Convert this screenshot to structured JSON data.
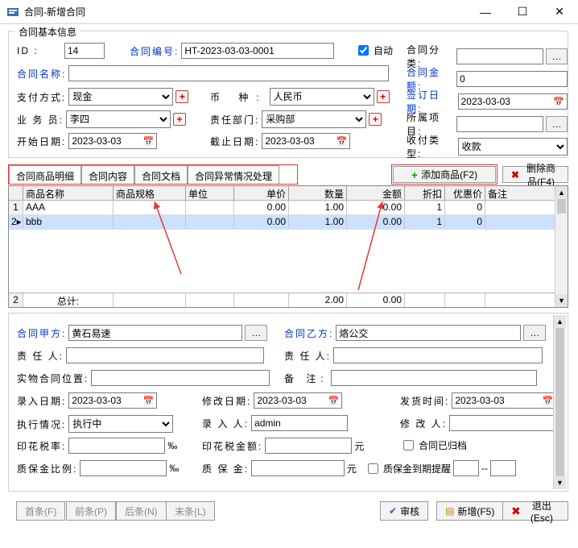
{
  "window": {
    "title": "合同-新增合同"
  },
  "basic": {
    "legend": "合同基本信息",
    "id_label": "ID    :",
    "id_value": "14",
    "code_label": "合同编号:",
    "code_value": "HT-2023-03-03-0001",
    "auto_label": "自动",
    "category_label": "合同分类:",
    "name_label": "合同名称:",
    "amount_label": "合同金额:",
    "amount_value": "0",
    "paymode_label": "支付方式:",
    "paymode_value": "现金",
    "currency_label": "币    种:",
    "currency_value": "人民币",
    "signdate_label": "签订日期:",
    "signdate_value": "2023-03-03",
    "salesman_label": "业 务 员:",
    "salesman_value": "李四",
    "dept_label": "责任部门:",
    "dept_value": "采购部",
    "project_label": "所属项目:",
    "start_label": "开始日期:",
    "start_value": "2023-03-03",
    "end_label": "截止日期:",
    "end_value": "2023-03-03",
    "rptype_label": "收付类型:",
    "rptype_value": "收款"
  },
  "tabs": {
    "t1": "合同商品明细",
    "t2": "合同内容",
    "t3": "合同文档",
    "t4": "合同异常情况处理",
    "add_btn": "添加商品(F2)",
    "del_btn": "删除商品(F4)"
  },
  "grid": {
    "headers": {
      "name": "商品名称",
      "spec": "商品规格",
      "unit": "单位",
      "price": "单价",
      "qty": "数量",
      "amt": "金额",
      "disc": "折扣",
      "off": "优惠价",
      "note": "备注"
    },
    "rows": [
      {
        "idx": "1",
        "name": "AAA",
        "spec": "",
        "unit": "",
        "price": "0.00",
        "qty": "1.00",
        "amt": "0.00",
        "disc": "1",
        "off": "0",
        "note": ""
      },
      {
        "idx": "2",
        "name": "bbb",
        "spec": "",
        "unit": "",
        "price": "0.00",
        "qty": "1.00",
        "amt": "0.00",
        "disc": "1",
        "off": "0",
        "note": ""
      }
    ],
    "footer": {
      "idx": "2",
      "label": "总计:",
      "qty": "2.00",
      "amt": "0.00"
    }
  },
  "party": {
    "a_label": "合同甲方:",
    "a_value": "黄石易速",
    "b_label": "合同乙方:",
    "b_value": "烙公交",
    "a_person_label": "责 任 人:",
    "b_person_label": "责 任 人:",
    "loc_label": "实物合同位置:",
    "remark_label": "备    注:",
    "entry_date_label": "录入日期:",
    "entry_date_value": "2023-03-03",
    "modify_date_label": "修改日期:",
    "modify_date_value": "2023-03-03",
    "ship_date_label": "发货时间:",
    "ship_date_value": "2023-03-03",
    "exec_label": "执行情况:",
    "exec_value": "执行中",
    "entry_by_label": "录 入 人:",
    "entry_by_value": "admin",
    "modify_by_label": "修 改 人:",
    "tax_rate_label": "印花税率:",
    "tax_rate_unit": "‰",
    "tax_amt_label": "印花税金额:",
    "yuan": "元",
    "archived_label": "合同已归档",
    "deposit_rate_label": "质保金比例:",
    "deposit_rate_unit": "‰",
    "deposit_label": "质 保 金:",
    "deposit_remind_label": "质保金到期提醒",
    "remind_sep": "--"
  },
  "nav": {
    "first": "首条(F)",
    "prev": "前条(P)",
    "next": "后条(N)",
    "last": "末条(L)",
    "audit": "审核",
    "new": "新增(F5)",
    "exit": "退出(Esc)"
  }
}
